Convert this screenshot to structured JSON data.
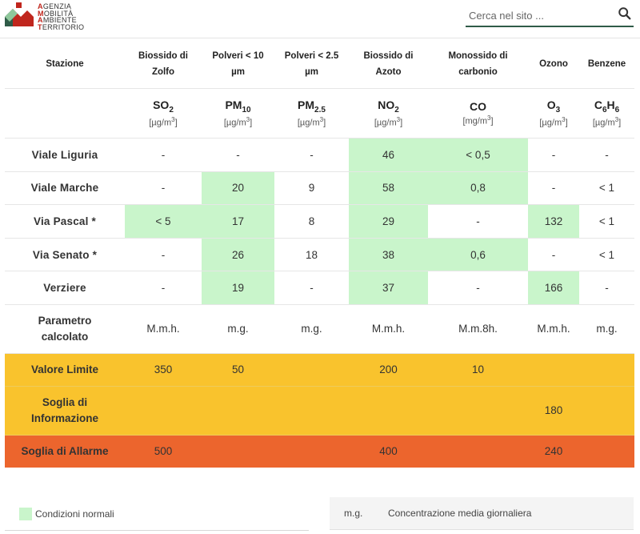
{
  "logo": {
    "lines": [
      {
        "cap": "A",
        "rest": "GENZIA"
      },
      {
        "cap": "M",
        "rest": "OBILITÀ"
      },
      {
        "cap": "A",
        "rest": "MBIENTE"
      },
      {
        "cap": "T",
        "rest": "ERRITORIO"
      }
    ],
    "colors": {
      "red": "#c0261d",
      "green": "#2f5b48",
      "dark": "#333333"
    }
  },
  "search": {
    "placeholder": "Cerca nel sito ...",
    "icon": "search-icon"
  },
  "table": {
    "headers": {
      "station": "Stazione",
      "so2_a": "Biossido di",
      "so2_b": "Zolfo",
      "pm10_a": "Polveri < 10",
      "pm10_b": "µm",
      "pm25_a": "Polveri < 2.5",
      "pm25_b": "µm",
      "no2_a": "Biossido di",
      "no2_b": "Azoto",
      "co_a": "Monossido di",
      "co_b": "carbonio",
      "o3": "Ozono",
      "benz": "Benzene"
    },
    "formulas": {
      "so2": {
        "main": "SO",
        "sub": "2",
        "unit": "[µg/m",
        "unit_sup": "3",
        "unit_end": "]"
      },
      "pm10": {
        "main": "PM",
        "sub": "10",
        "unit": "[µg/m",
        "unit_sup": "3",
        "unit_end": "]"
      },
      "pm25": {
        "main": "PM",
        "sub": "2.5",
        "unit": "[µg/m",
        "unit_sup": "3",
        "unit_end": "]"
      },
      "no2": {
        "main": "NO",
        "sub": "2",
        "unit": "[µg/m",
        "unit_sup": "3",
        "unit_end": "]"
      },
      "co": {
        "main": "CO",
        "sub": "",
        "unit": "[mg/m",
        "unit_sup": "3",
        "unit_end": "]"
      },
      "o3": {
        "main": "O",
        "sub": "3",
        "unit": "[µg/m",
        "unit_sup": "3",
        "unit_end": "]"
      },
      "benz": {
        "main": "C",
        "sub": "6",
        "main2": "H",
        "sub2": "6",
        "unit": "[µg/m",
        "unit_sup": "3",
        "unit_end": "]"
      }
    },
    "stations": [
      {
        "name": "Viale Liguria",
        "so2": "-",
        "pm10": "-",
        "pm25": "-",
        "no2": "46",
        "co": "< 0,5",
        "o3": "-",
        "benz": "-"
      },
      {
        "name": "Viale Marche",
        "so2": "-",
        "pm10": "20",
        "pm25": "9",
        "no2": "58",
        "co": "0,8",
        "o3": "-",
        "benz": "< 1"
      },
      {
        "name": "Via Pascal *",
        "so2": "< 5",
        "pm10": "17",
        "pm25": "8",
        "no2": "29",
        "co": "-",
        "o3": "132",
        "benz": "< 1"
      },
      {
        "name": "Via Senato *",
        "so2": "-",
        "pm10": "26",
        "pm25": "18",
        "no2": "38",
        "co": "0,6",
        "o3": "-",
        "benz": "< 1"
      },
      {
        "name": "Verziere",
        "so2": "-",
        "pm10": "19",
        "pm25": "-",
        "no2": "37",
        "co": "-",
        "o3": "166",
        "benz": "-"
      }
    ],
    "param": {
      "label_a": "Parametro",
      "label_b": "calcolato",
      "so2": "M.m.h.",
      "pm10": "m.g.",
      "pm25": "m.g.",
      "no2": "M.m.h.",
      "co": "M.m.8h.",
      "o3": "M.m.h.",
      "benz": "m.g."
    },
    "limit": {
      "label": "Valore Limite",
      "so2": "350",
      "pm10": "50",
      "pm25": "",
      "no2": "200",
      "co": "10",
      "o3": "",
      "benz": ""
    },
    "info": {
      "label_a": "Soglia di",
      "label_b": "Informazione",
      "so2": "",
      "pm10": "",
      "pm25": "",
      "no2": "",
      "co": "",
      "o3": "180",
      "benz": ""
    },
    "alarm": {
      "label": "Soglia di Allarme",
      "so2": "500",
      "pm10": "",
      "pm25": "",
      "no2": "400",
      "co": "",
      "o3": "240",
      "benz": ""
    }
  },
  "legend": {
    "swatch_label": "Condizioni normali",
    "abbr": "m.g.",
    "abbr_desc": "Concentrazione media giornaliera"
  },
  "colors": {
    "normal_green": "#c9f5cb",
    "limit_yellow": "#f9c32d",
    "alarm_orange": "#ec652d",
    "station_text": "#2f5b48"
  }
}
